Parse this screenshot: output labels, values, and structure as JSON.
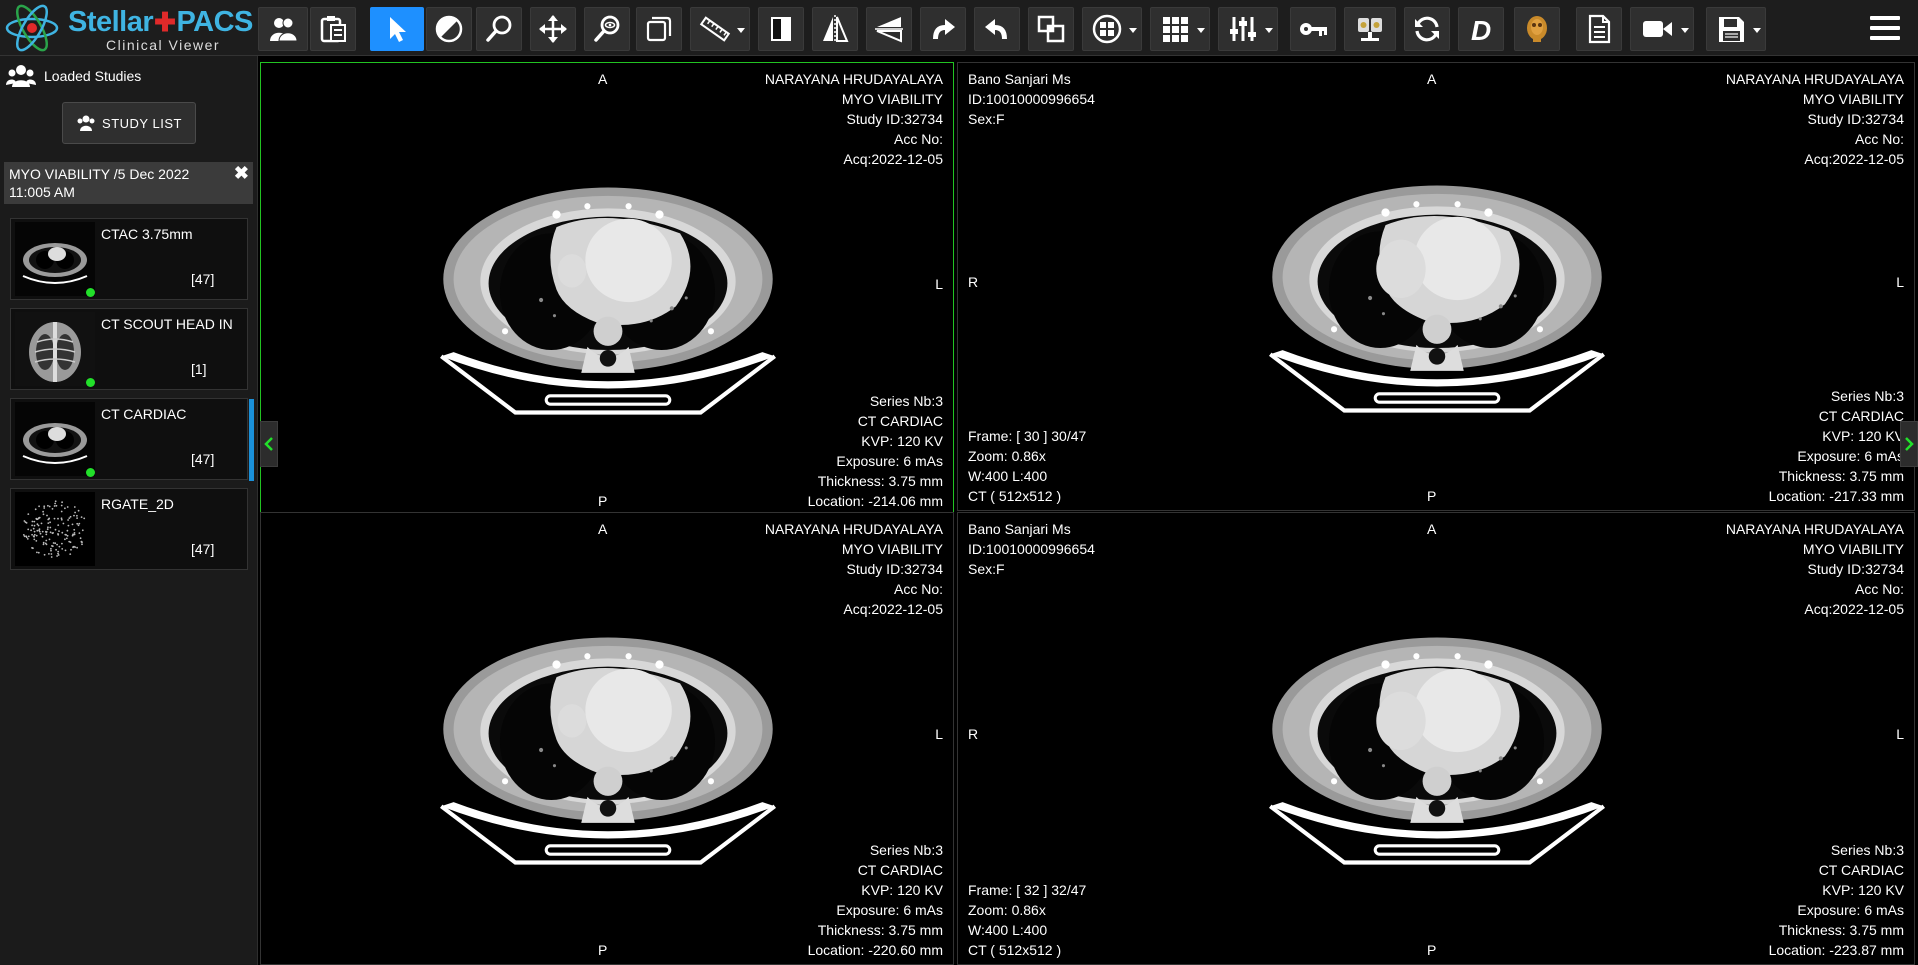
{
  "app": {
    "logo_title_a": "Stellar",
    "logo_title_b": "PACS",
    "logo_subtitle": "Clinical Viewer"
  },
  "toolbar": {
    "buttons": [
      {
        "name": "patients-icon",
        "dropdown": false
      },
      {
        "name": "clipboard-icon",
        "dropdown": false
      },
      {
        "name": "pointer-icon",
        "dropdown": false,
        "active": true
      },
      {
        "name": "window-level-icon",
        "dropdown": false
      },
      {
        "name": "zoom-icon",
        "dropdown": false
      },
      {
        "name": "pan-icon",
        "dropdown": false
      },
      {
        "name": "magnify-icon",
        "dropdown": false
      },
      {
        "name": "stack-icon",
        "dropdown": false
      },
      {
        "name": "ruler-icon",
        "dropdown": true
      },
      {
        "name": "invert-icon",
        "dropdown": false
      },
      {
        "name": "flip-horizontal-icon",
        "dropdown": false
      },
      {
        "name": "flip-vertical-icon",
        "dropdown": false
      },
      {
        "name": "rotate-right-icon",
        "dropdown": false
      },
      {
        "name": "rotate-left-icon",
        "dropdown": false
      },
      {
        "name": "reset-icon",
        "dropdown": false
      },
      {
        "name": "layout-icon",
        "dropdown": true
      },
      {
        "name": "grid-icon",
        "dropdown": true
      },
      {
        "name": "adjust-icon",
        "dropdown": true
      },
      {
        "name": "key-icon",
        "dropdown": false
      },
      {
        "name": "cine-icon",
        "dropdown": false
      },
      {
        "name": "sync-icon",
        "dropdown": false
      },
      {
        "name": "d-icon",
        "dropdown": false
      },
      {
        "name": "3d-head-icon",
        "dropdown": false
      },
      {
        "name": "report-icon",
        "dropdown": false
      },
      {
        "name": "video-icon",
        "dropdown": true
      },
      {
        "name": "save-icon",
        "dropdown": true
      }
    ],
    "menu_icon": "hamburger-icon"
  },
  "sidebar": {
    "loaded_studies_label": "Loaded Studies",
    "study_list_label": "STUDY LIST",
    "study_header": "MYO VIABILITY /5 Dec 2022 11:005 AM",
    "close_symbol": "✖",
    "series": [
      {
        "name": "CTAC 3.75mm",
        "count": "[47]",
        "loaded": true,
        "selected": false,
        "thumb": "axial"
      },
      {
        "name": "CT SCOUT HEAD IN",
        "count": "[1]",
        "loaded": true,
        "selected": false,
        "thumb": "scout"
      },
      {
        "name": "CT CARDIAC",
        "count": "[47]",
        "loaded": true,
        "selected": true,
        "thumb": "axial"
      },
      {
        "name": "RGATE_2D",
        "count": "[47]",
        "loaded": false,
        "selected": false,
        "thumb": "noise"
      }
    ]
  },
  "viewports": [
    {
      "selected": true,
      "orient": {
        "top": "A",
        "bottom": "P",
        "left": "",
        "right": "L"
      },
      "patient": [],
      "study": [
        "NARAYANA HRUDAYALAYA",
        "MYO VIABILITY",
        "Study ID:32734",
        "Acc No:",
        "Acq:2022-12-05"
      ],
      "image_info": [],
      "series_info": [
        "Series Nb:3",
        "CT CARDIAC",
        "KVP: 120 KV",
        "Exposure: 6 mAs",
        "Thickness: 3.75 mm",
        "Location: -214.06 mm"
      ]
    },
    {
      "selected": false,
      "orient": {
        "top": "A",
        "bottom": "P",
        "left": "R",
        "right": "L"
      },
      "patient": [
        "Bano Sanjari Ms",
        "ID:10010000996654",
        "Sex:F"
      ],
      "study": [
        "NARAYANA HRUDAYALAYA",
        "MYO VIABILITY",
        "Study ID:32734",
        "Acc No:",
        "Acq:2022-12-05"
      ],
      "image_info": [
        "Frame: [ 30 ] 30/47",
        "Zoom: 0.86x",
        "W:400 L:400",
        "CT ( 512x512 )"
      ],
      "series_info": [
        "Series Nb:3",
        "CT CARDIAC",
        "KVP: 120 KV",
        "Exposure: 6 mAs",
        "Thickness: 3.75 mm",
        "Location: -217.33 mm"
      ]
    },
    {
      "selected": false,
      "orient": {
        "top": "A",
        "bottom": "P",
        "left": "",
        "right": "L"
      },
      "patient": [],
      "study": [
        "NARAYANA HRUDAYALAYA",
        "MYO VIABILITY",
        "Study ID:32734",
        "Acc No:",
        "Acq:2022-12-05"
      ],
      "image_info": [],
      "series_info": [
        "Series Nb:3",
        "CT CARDIAC",
        "KVP: 120 KV",
        "Exposure: 6 mAs",
        "Thickness: 3.75 mm",
        "Location: -220.60 mm"
      ]
    },
    {
      "selected": false,
      "orient": {
        "top": "A",
        "bottom": "P",
        "left": "R",
        "right": "L"
      },
      "patient": [
        "Bano Sanjari Ms",
        "ID:10010000996654",
        "Sex:F"
      ],
      "study": [
        "NARAYANA HRUDAYALAYA",
        "MYO VIABILITY",
        "Study ID:32734",
        "Acc No:",
        "Acq:2022-12-05"
      ],
      "image_info": [
        "Frame: [ 32 ] 32/47",
        "Zoom: 0.86x",
        "W:400 L:400",
        "CT ( 512x512 )"
      ],
      "series_info": [
        "Series Nb:3",
        "CT CARDIAC",
        "KVP: 120 KV",
        "Exposure: 6 mAs",
        "Thickness: 3.75 mm",
        "Location: -223.87 mm"
      ]
    }
  ],
  "colors": {
    "active_tool": "#1e90ff",
    "selected_viewport": "#22c322",
    "loaded_dot": "#22e02a",
    "brand": "#3fb4e2"
  }
}
